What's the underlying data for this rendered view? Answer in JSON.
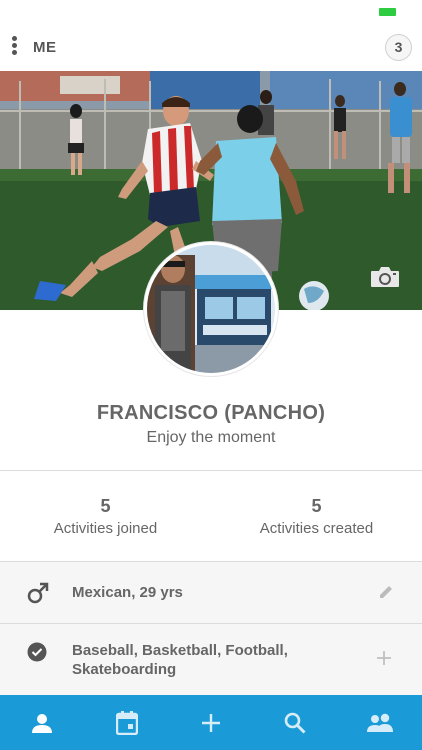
{
  "header": {
    "title": "ME",
    "notification_count": "3"
  },
  "profile": {
    "name": "FRANCISCO (PANCHO)",
    "tagline": "Enjoy the moment"
  },
  "stats": [
    {
      "count": "5",
      "label": "Activities joined"
    },
    {
      "count": "5",
      "label": "Activities created"
    }
  ],
  "info": {
    "gender_icon": "male-icon",
    "nationality_age": "Mexican, 29 yrs",
    "sports_icon": "check-circle-icon",
    "sports_line1": "Baseball, Basketball, Football,",
    "sports_line2": "Skateboarding"
  },
  "tab_bar": {
    "items": [
      "profile-icon",
      "calendar-icon",
      "add-icon",
      "search-icon",
      "friends-icon"
    ],
    "active": "profile-icon"
  },
  "colors": {
    "accent": "#1a9bd7",
    "text": "#666666",
    "battery": "#2ecc40"
  }
}
